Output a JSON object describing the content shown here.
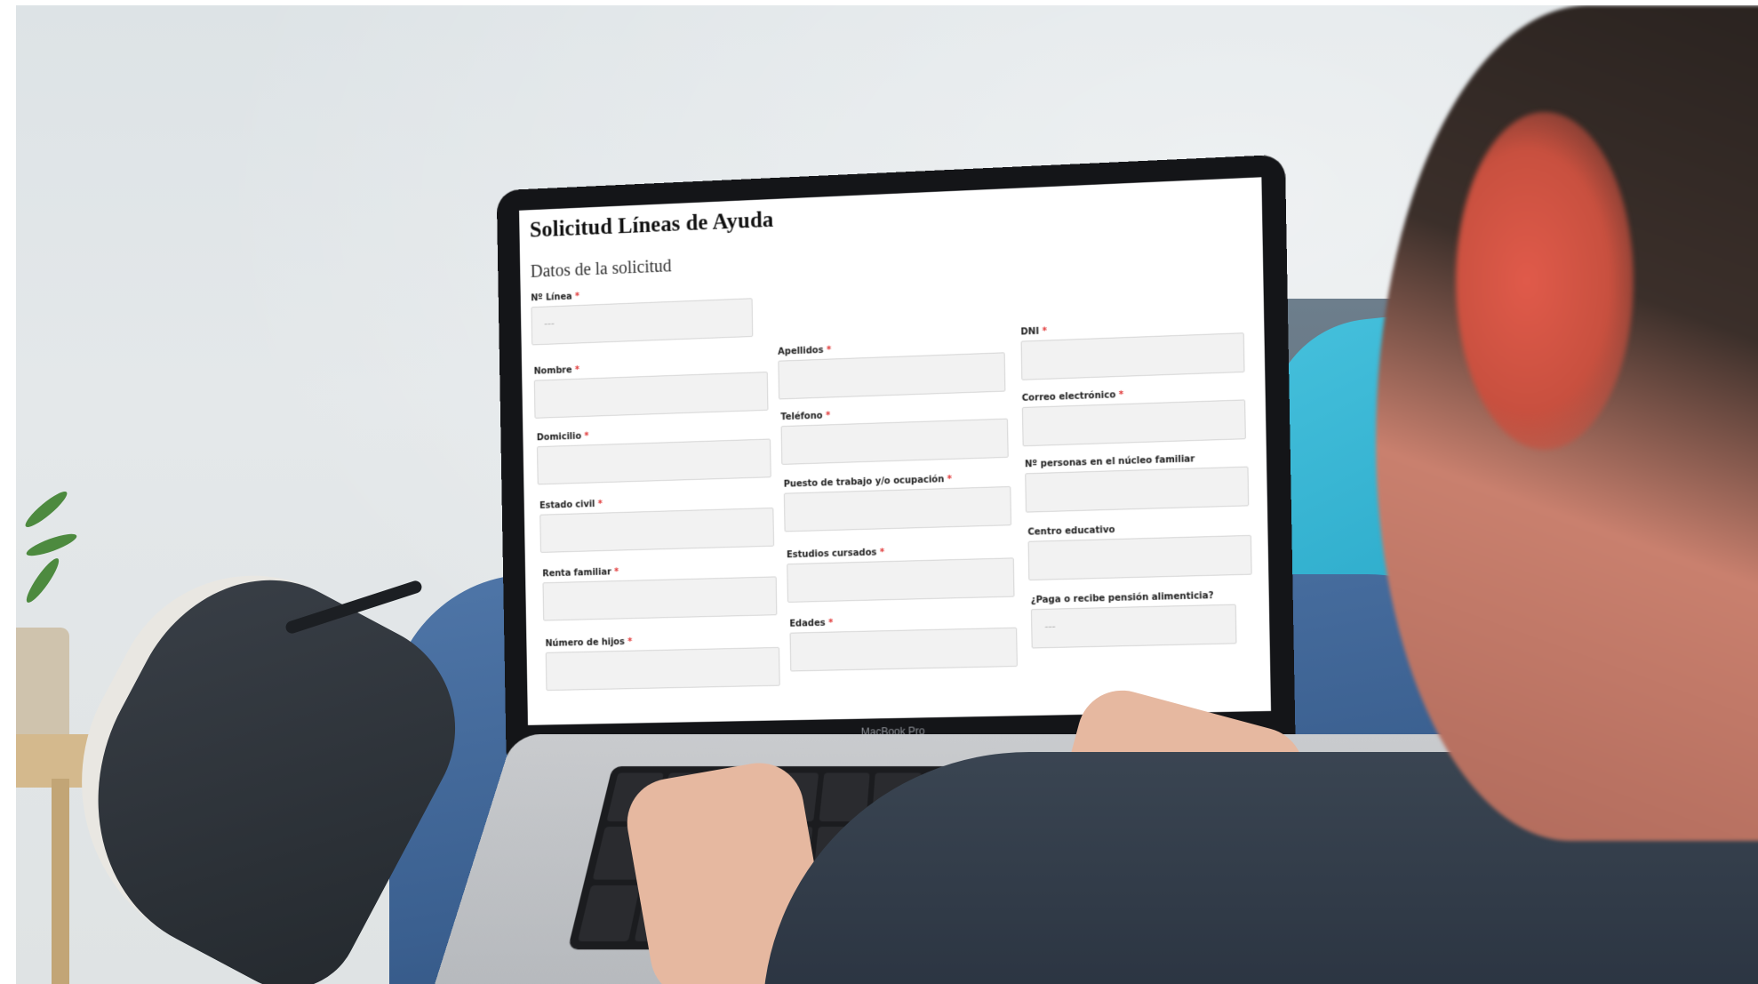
{
  "laptop": {
    "brand": "MacBook Pro"
  },
  "form": {
    "title": "Solicitud Líneas de Ayuda",
    "subtitle": "Datos de la solicitud",
    "required_marker": "*",
    "fields": {
      "numero_linea": {
        "label": "Nº Línea",
        "placeholder": "---"
      },
      "nombre": {
        "label": "Nombre"
      },
      "apellidos": {
        "label": "Apellidos"
      },
      "dni": {
        "label": "DNI"
      },
      "domicilio": {
        "label": "Domicilio"
      },
      "telefono": {
        "label": "Teléfono"
      },
      "correo": {
        "label": "Correo electrónico"
      },
      "estado_civil": {
        "label": "Estado civil"
      },
      "puesto": {
        "label": "Puesto de trabajo y/o ocupación"
      },
      "personas_nucleo": {
        "label": "Nº personas en el núcleo familiar"
      },
      "renta": {
        "label": "Renta familiar"
      },
      "estudios": {
        "label": "Estudios cursados"
      },
      "centro": {
        "label": "Centro educativo"
      },
      "hijos": {
        "label": "Número de hijos"
      },
      "edades": {
        "label": "Edades"
      },
      "pension": {
        "label": "¿Paga o recibe pensión alimenticia?",
        "placeholder": "---"
      }
    }
  },
  "colors": {
    "required": "#e03434",
    "cushion": "#2aa9c9",
    "input_bg": "#f2f2f2"
  }
}
